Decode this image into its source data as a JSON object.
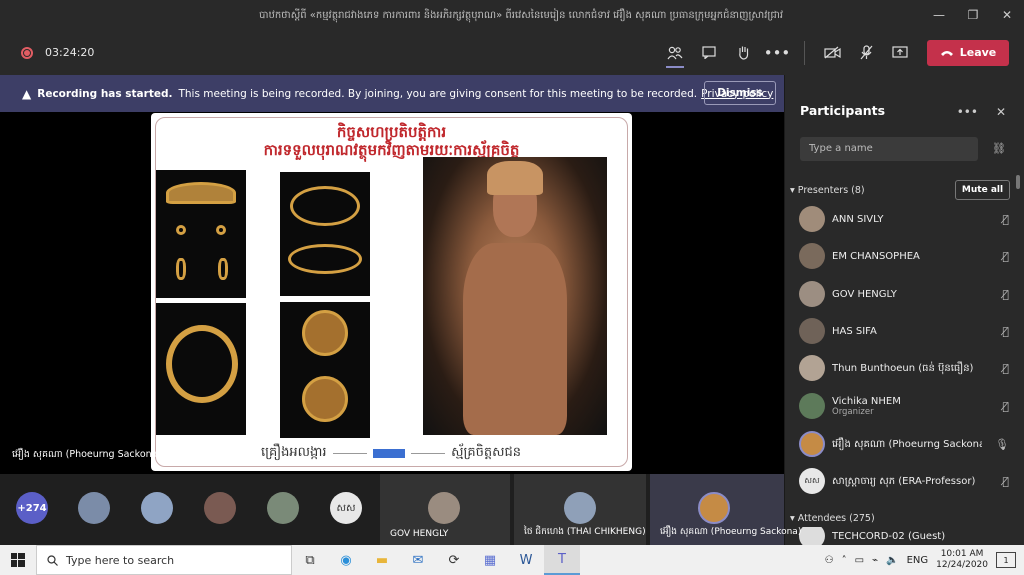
{
  "window": {
    "title": "បាឋកថាស្តីពី «កម្មវត្ថុរាជវាងភេទ ការការពារ និងអភិរក្សវត្ថុបុរាណ» ពីរវេសនៃមេរៀន លោកជំទាវ អ៊ឿង សុគណា ប្រធានក្រុមអ្នកជំនាញស្រាវជ្រាវ",
    "minimize": "—",
    "restore": "❐",
    "close": "✕"
  },
  "toolbar": {
    "timer": "03:24:20",
    "leave_label": "Leave",
    "leave_icon": "phone"
  },
  "banner": {
    "title": "Recording has started.",
    "text": "This meeting is being recorded. By joining, you are giving consent for this meeting to be recorded.",
    "link": "Privacy policy",
    "dismiss": "Dismiss"
  },
  "slide": {
    "title_line1": "កិច្ចសហប្រតិបត្តិការ",
    "title_line2": "ការទទួលបុរាណវត្ថុមកវិញតាមរយៈការស្ម័គ្រចិត្ត",
    "footer_left": "គ្រឿងអលង្ការ",
    "footer_right": "ស្ម័គ្រចិត្តសជន"
  },
  "stage": {
    "presenter_name": "អ៊ឿង សុគណា (Phoeurng Sackona)"
  },
  "panel": {
    "title": "Participants",
    "search_placeholder": "Type a name",
    "presenters_label": "Presenters (8)",
    "mute_all": "Mute all",
    "attendees_label": "Attendees (275)",
    "participants": [
      {
        "name": "ANN SIVLY",
        "role": ""
      },
      {
        "name": "EM CHANSOPHEA",
        "role": ""
      },
      {
        "name": "GOV HENGLY",
        "role": ""
      },
      {
        "name": "HAS SIFA",
        "role": ""
      },
      {
        "name": "Thun Bunthoeun (ធន់ ប៊ុនធឿន)",
        "role": ""
      },
      {
        "name": "Vichika NHEM",
        "role": "Organizer"
      },
      {
        "name": "អ៊ឿង សុគណា (Phoeurng Sackona)",
        "role": ""
      },
      {
        "name": "សាស្ត្រាចារ្យ សុភ (ERA-Professor)",
        "role": ""
      }
    ],
    "attendee_first": "TECHCORD-02 (Guest)"
  },
  "gallery": {
    "overflow_count": "+274",
    "initials": "សស",
    "tiles": [
      {
        "caption": "GOV HENGLY"
      },
      {
        "caption": "ថៃ ជិកហេង (THAI CHIKHENG)"
      },
      {
        "caption": "អ៊ឿង សុគណា (Phoeurng Sackona)"
      }
    ]
  },
  "taskbar": {
    "search_placeholder": "Type here to search",
    "language": "ENG",
    "time": "10:01 AM",
    "date": "12/24/2020",
    "notifications": "1"
  },
  "colors": {
    "leave": "#c4314b",
    "banner": "#3d3e66",
    "slide_title": "#c0282d"
  }
}
